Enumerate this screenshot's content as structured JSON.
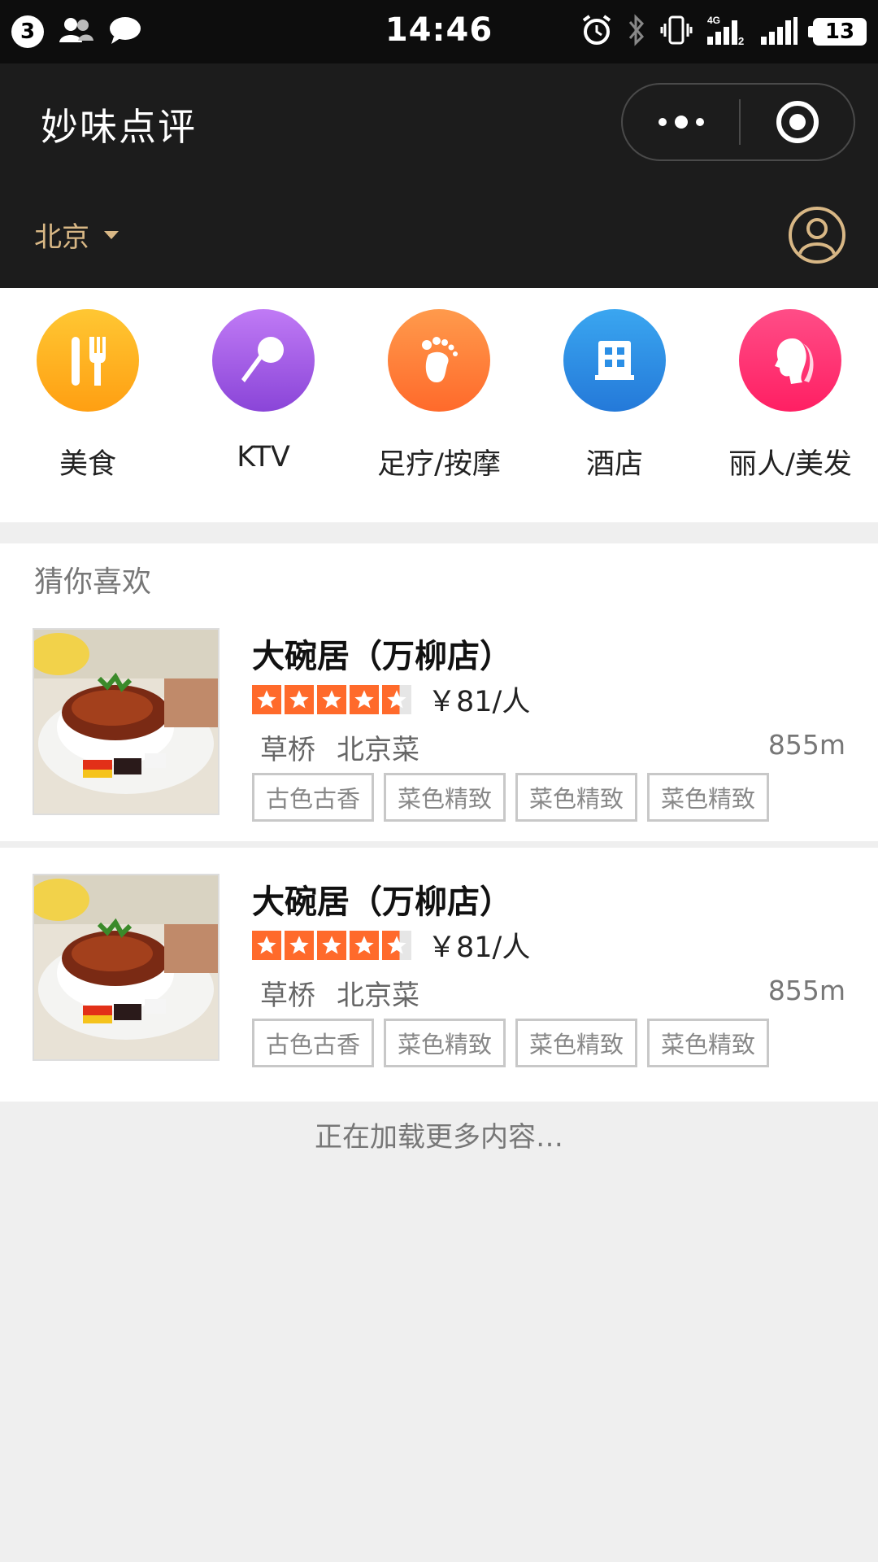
{
  "status_bar": {
    "notification_count": "3",
    "time": "14:46",
    "network": "4G",
    "sim2": "2",
    "battery": "13"
  },
  "header": {
    "title": "妙味点评",
    "city": "北京"
  },
  "categories": [
    {
      "label": "美食",
      "icon": "fork-knife-icon",
      "color": "#ffb31f"
    },
    {
      "label": "KTV",
      "icon": "microphone-icon",
      "color": "#a35be6"
    },
    {
      "label": "足疗/按摩",
      "icon": "footprint-icon",
      "color": "#ff7f3a"
    },
    {
      "label": "酒店",
      "icon": "building-icon",
      "color": "#2b8fe6"
    },
    {
      "label": "丽人/美发",
      "icon": "woman-profile-icon",
      "color": "#ff2f74"
    }
  ],
  "recommend": {
    "title": "猜你喜欢",
    "items": [
      {
        "name": "大碗居（万柳店）",
        "rating": 4.5,
        "price": "￥81/人",
        "area": "草桥",
        "cuisine": "北京菜",
        "distance": "855m",
        "tags": [
          "古色古香",
          "菜色精致",
          "菜色精致",
          "菜色精致"
        ]
      },
      {
        "name": "大碗居（万柳店）",
        "rating": 4.5,
        "price": "￥81/人",
        "area": "草桥",
        "cuisine": "北京菜",
        "distance": "855m",
        "tags": [
          "古色古香",
          "菜色精致",
          "菜色精致",
          "菜色精致"
        ]
      }
    ]
  },
  "loading_text": "正在加载更多内容…",
  "colors": {
    "header_bg": "#1c1c1c",
    "accent_gold": "#d8b785",
    "star_orange": "#ff6a2b"
  }
}
